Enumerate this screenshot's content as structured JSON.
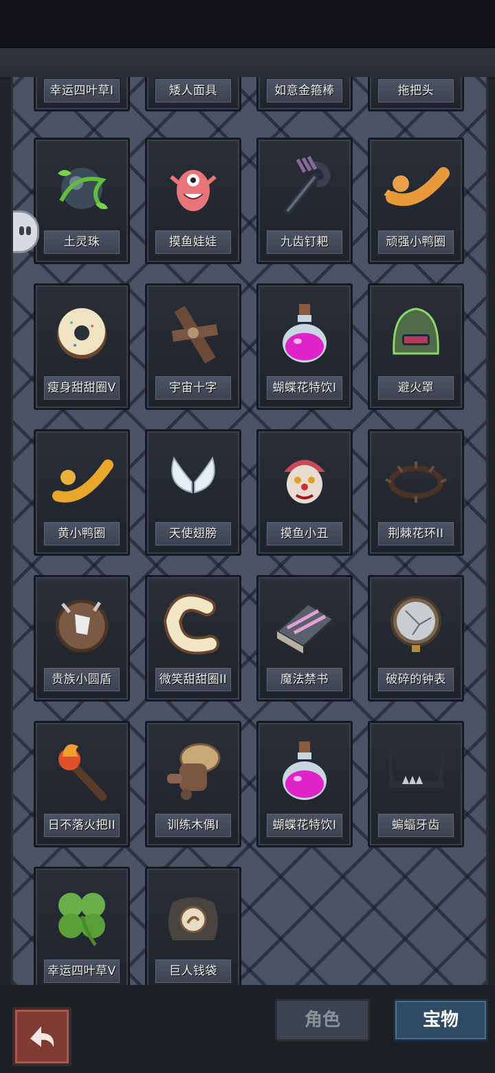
{
  "top_row_partial": [
    "幸运四叶草I",
    "矮人面具",
    "如意金箍棒",
    "拖把头"
  ],
  "items": [
    {
      "name": "土灵珠",
      "icon": "earth-orb-icon"
    },
    {
      "name": "摸鱼娃娃",
      "icon": "pink-doll-icon"
    },
    {
      "name": "九齿钉耙",
      "icon": "rake-icon"
    },
    {
      "name": "顽强小鸭圈",
      "icon": "duck-ring-icon"
    },
    {
      "name": "瘦身甜甜圈V",
      "icon": "donut-icon"
    },
    {
      "name": "宇宙十字",
      "icon": "wood-cross-icon"
    },
    {
      "name": "蝴蝶花特饮I",
      "icon": "potion-icon"
    },
    {
      "name": "避火罩",
      "icon": "helmet-icon"
    },
    {
      "name": "黄小鸭圈",
      "icon": "yellow-duck-ring-icon"
    },
    {
      "name": "天使翅膀",
      "icon": "angel-wings-icon"
    },
    {
      "name": "摸鱼小丑",
      "icon": "clown-mask-icon"
    },
    {
      "name": "荆棘花环II",
      "icon": "thorn-wreath-icon"
    },
    {
      "name": "贵族小圆盾",
      "icon": "round-shield-icon"
    },
    {
      "name": "微笑甜甜圈II",
      "icon": "smile-donut-icon"
    },
    {
      "name": "魔法禁书",
      "icon": "spell-book-icon"
    },
    {
      "name": "破碎的钟表",
      "icon": "broken-watch-icon"
    },
    {
      "name": "日不落火把II",
      "icon": "torch-icon"
    },
    {
      "name": "训练木偶I",
      "icon": "training-dummy-icon"
    },
    {
      "name": "蝴蝶花特饮I",
      "icon": "potion-icon"
    },
    {
      "name": "蝙蝠牙齿",
      "icon": "bat-teeth-icon"
    },
    {
      "name": "幸运四叶草V",
      "icon": "clover-icon"
    },
    {
      "name": "巨人钱袋",
      "icon": "money-bag-icon"
    }
  ],
  "tabs": {
    "role": "角色",
    "treasure": "宝物"
  },
  "colors": {
    "accent_tab": "#2f4a63",
    "back_button": "#7e3a33",
    "potion": "#e023c8"
  }
}
